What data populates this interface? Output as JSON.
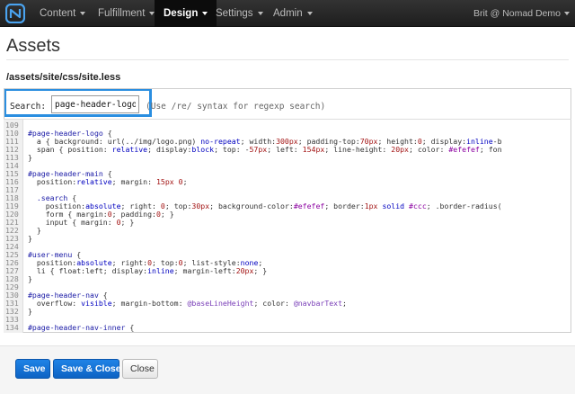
{
  "nav": {
    "items": [
      {
        "label": "Content",
        "active": false
      },
      {
        "label": "Fulfillment",
        "active": false
      },
      {
        "label": "Design",
        "active": true
      },
      {
        "label": "Settings",
        "active": false
      },
      {
        "label": "Admin",
        "active": false
      }
    ],
    "user": "Brit @ Nomad Demo"
  },
  "page": {
    "title": "Assets",
    "path": "/assets/site/css/site.less"
  },
  "search": {
    "label": "Search:",
    "value": "page-header-logo",
    "hint": "(Use /re/ syntax for regexp search)"
  },
  "code": {
    "lines": [
      {
        "n": "109",
        "text": ""
      },
      {
        "n": "110",
        "text": "#page-header-logo {"
      },
      {
        "n": "111",
        "text": "  a { background: url(../img/logo.png) no-repeat; width:300px; padding-top:70px; height:0; display:inline-b"
      },
      {
        "n": "112",
        "text": "  span { position: relative; display:block; top: -57px; left: 154px; line-height: 20px; color: #efefef; fon"
      },
      {
        "n": "113",
        "text": "}"
      },
      {
        "n": "114",
        "text": ""
      },
      {
        "n": "115",
        "text": "#page-header-main {"
      },
      {
        "n": "116",
        "text": "  position:relative; margin: 15px 0;"
      },
      {
        "n": "117",
        "text": ""
      },
      {
        "n": "118",
        "text": "  .search {"
      },
      {
        "n": "119",
        "text": "    position:absolute; right: 0; top:30px; background-color:#efefef; border:1px solid #ccc; .border-radius("
      },
      {
        "n": "120",
        "text": "    form { margin:0; padding:0; }"
      },
      {
        "n": "121",
        "text": "    input { margin: 0; }"
      },
      {
        "n": "122",
        "text": "  }"
      },
      {
        "n": "123",
        "text": "}"
      },
      {
        "n": "124",
        "text": ""
      },
      {
        "n": "125",
        "text": "#user-menu {"
      },
      {
        "n": "126",
        "text": "  position:absolute; right:0; top:0; list-style:none;"
      },
      {
        "n": "127",
        "text": "  li { float:left; display:inline; margin-left:20px; }"
      },
      {
        "n": "128",
        "text": "}"
      },
      {
        "n": "129",
        "text": ""
      },
      {
        "n": "130",
        "text": "#page-header-nav {"
      },
      {
        "n": "131",
        "text": "  overflow: visible; margin-bottom: @baseLineHeight; color: @navbarText;"
      },
      {
        "n": "132",
        "text": "}"
      },
      {
        "n": "133",
        "text": ""
      },
      {
        "n": "134",
        "text": "#page-header-nav-inner {"
      }
    ]
  },
  "footer": {
    "save": "Save",
    "save_close": "Save & Close",
    "close": "Close"
  },
  "colors": {
    "accent": "#2a8ee0",
    "primary_button": "#0d63c4",
    "navbar": "#1e1e1e"
  },
  "icons": {
    "logo": "nomad-logo-icon",
    "caret": "caret-down-icon"
  }
}
